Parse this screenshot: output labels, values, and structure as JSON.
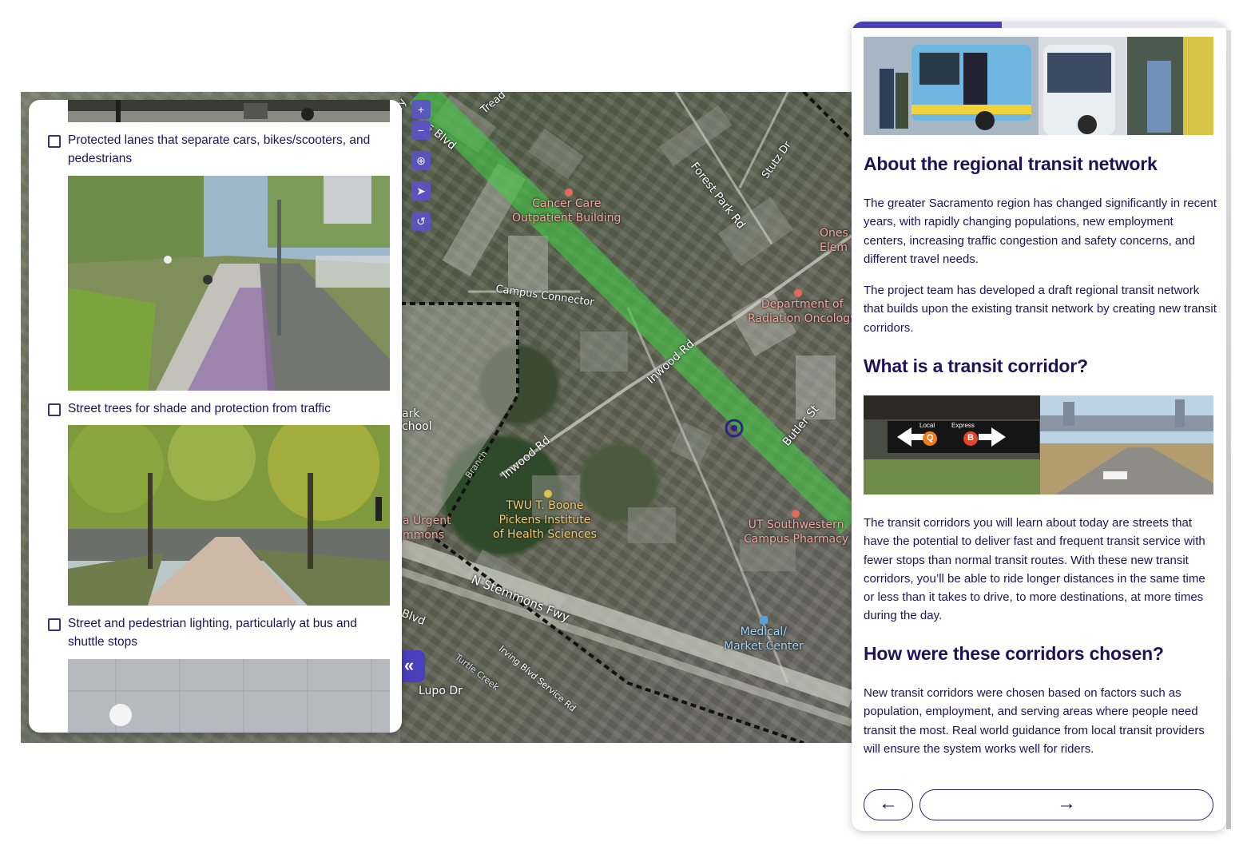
{
  "map": {
    "labels": {
      "cancer_care": "Cancer Care\nOutpatient Building",
      "forest_park_rd": "Forest Park Rd",
      "stutz_dr": "Stutz Dr",
      "campus_connector": "Campus Connector",
      "dept_radiation": "Department of\nRadiation Oncology",
      "ones_elem": "Ones\nElem",
      "inwood_rd_1": "Inwood Rd",
      "inwood_rd_2": "Inwood Rd",
      "butler_st": "Butler St",
      "park_school": "ark\nchool",
      "twu_boone": "TWU T. Boone\nPickens Institute\nof Health Sciences",
      "ut_southwestern": "UT Southwestern\nCampus Pharmacy",
      "urgent": "a Urgent\nmmons",
      "n_stemmons_fwy": "N Stemmons Fwy",
      "blvd": "Blvd",
      "medical_market": "Medical/\nMarket Center",
      "irving_blvd": "Irving Blvd Service Rd",
      "turtle_creek": "Turtle Creek",
      "lupo_dr": "Lupo Dr",
      "treadway": "Tread",
      "blvd_top": "s Blvd",
      "ry": "ry"
    },
    "controls": {
      "zoom_in": "+",
      "zoom_out": "−",
      "zoom_search": "⊕",
      "locate": "➤",
      "reset": "↺"
    },
    "collapse_label": "«"
  },
  "left_panel": {
    "items": [
      {
        "label": "Protected lanes that separate cars, bikes/scooters, and pedestrians",
        "checked": false
      },
      {
        "label": "Street trees for shade and protection from traffic",
        "checked": false
      },
      {
        "label": "Street and pedestrian lighting, particularly at bus and shuttle stops",
        "checked": false
      }
    ]
  },
  "right_panel": {
    "progress": 0.4,
    "headings": {
      "about": "About the regional transit network",
      "what_is": "What is a transit corridor?",
      "how_chosen": "How were these corridors chosen?"
    },
    "paragraphs": {
      "p1": "The greater Sacramento region has changed significantly in recent years, with rapidly changing populations, new employment centers, increasing traffic congestion and safety concerns, and different travel needs.",
      "p2": "The project team has developed a draft regional transit network that builds upon the existing transit network by creating new transit corridors.",
      "p3": "The transit corridors you will learn about today are streets that have the potential to deliver fast and frequent transit service with fewer stops than normal transit routes. With these new transit corridors, you’ll be able to ride longer distances in the same time or less than it takes to drive, to more destinations, at more times during the day.",
      "p4": "New transit corridors were chosen based on factors such as population, employment, and serving areas where people need transit the most. Real world guidance from local transit providers will ensure the system works well for riders."
    },
    "sign": {
      "local": "Local",
      "express": "Express",
      "q": "Q",
      "b": "B"
    },
    "nav": {
      "prev": "←",
      "next": "→"
    }
  },
  "colors": {
    "accent": "#4a3fbd",
    "text": "#1f1259",
    "corridor": "#4cd44a",
    "boundary": "#111111"
  }
}
